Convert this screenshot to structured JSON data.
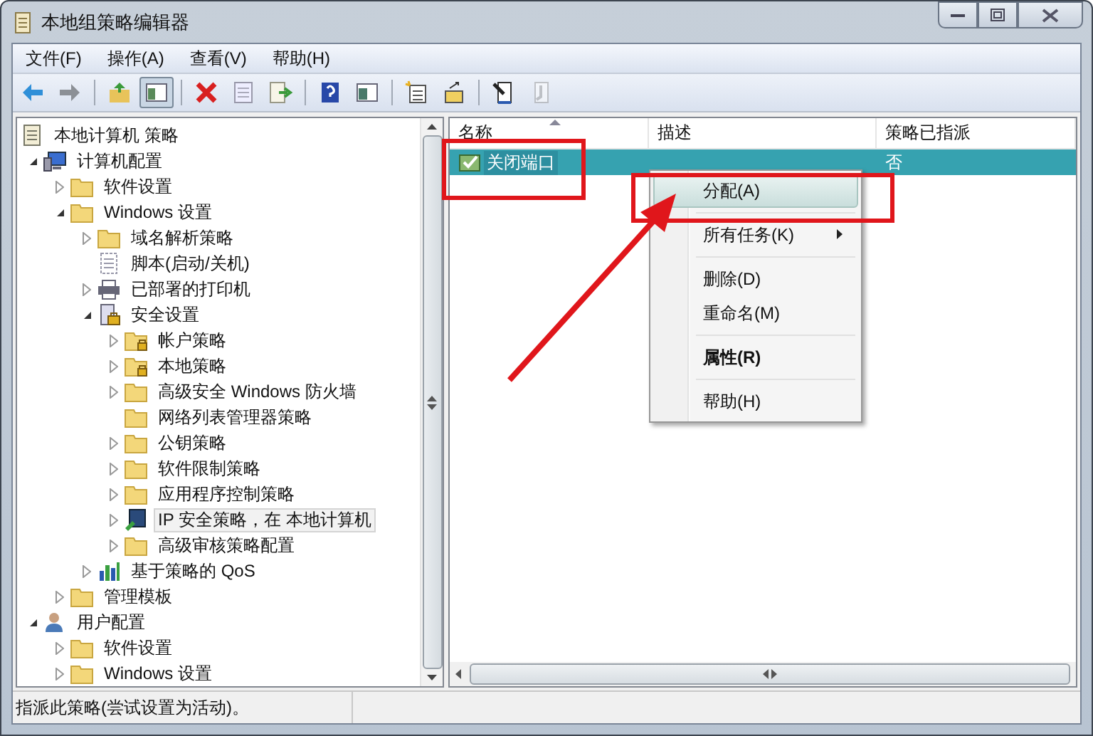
{
  "window": {
    "title": "本地组策略编辑器"
  },
  "menu": [
    {
      "label": "文件(F)"
    },
    {
      "label": "操作(A)"
    },
    {
      "label": "查看(V)"
    },
    {
      "label": "帮助(H)"
    }
  ],
  "toolbar": [
    {
      "kind": "back",
      "separator_before": false,
      "pressed": false,
      "disabled": false
    },
    {
      "kind": "forward",
      "separator_before": false,
      "pressed": false,
      "disabled": false
    },
    {
      "kind": "up",
      "separator_before": true,
      "pressed": false,
      "disabled": false
    },
    {
      "kind": "tree",
      "separator_before": false,
      "pressed": true,
      "disabled": false
    },
    {
      "kind": "delete",
      "separator_before": true,
      "pressed": false,
      "disabled": false
    },
    {
      "kind": "properties",
      "separator_before": false,
      "pressed": false,
      "disabled": false
    },
    {
      "kind": "export",
      "separator_before": false,
      "pressed": false,
      "disabled": false
    },
    {
      "kind": "help",
      "separator_before": true,
      "pressed": false,
      "disabled": false
    },
    {
      "kind": "view",
      "separator_before": false,
      "pressed": false,
      "disabled": false
    },
    {
      "kind": "new",
      "separator_before": true,
      "pressed": false,
      "disabled": false
    },
    {
      "kind": "manage",
      "separator_before": false,
      "pressed": false,
      "disabled": false
    },
    {
      "kind": "assign",
      "separator_before": true,
      "pressed": false,
      "disabled": false
    },
    {
      "kind": "unassign",
      "separator_before": false,
      "pressed": false,
      "disabled": true
    }
  ],
  "tree": {
    "label": "本地计算机 策略",
    "kind": "policy",
    "selected": false,
    "children": [
      {
        "label": "计算机配置",
        "kind": "computer",
        "expanded": true,
        "selected": false,
        "children": [
          {
            "label": "软件设置",
            "kind": "folder",
            "expanded": false,
            "selected": false
          },
          {
            "label": "Windows 设置",
            "kind": "folder",
            "expanded": true,
            "selected": false,
            "children": [
              {
                "label": "域名解析策略",
                "kind": "folder",
                "expanded": false,
                "selected": false
              },
              {
                "label": "脚本(启动/关机)",
                "kind": "script",
                "selected": false
              },
              {
                "label": "已部署的打印机",
                "kind": "printer",
                "expanded": false,
                "selected": false
              },
              {
                "label": "安全设置",
                "kind": "security",
                "expanded": true,
                "selected": false,
                "children": [
                  {
                    "label": "帐户策略",
                    "kind": "lockfolder",
                    "expanded": false,
                    "selected": false
                  },
                  {
                    "label": "本地策略",
                    "kind": "lockfolder",
                    "expanded": false,
                    "selected": false
                  },
                  {
                    "label": "高级安全 Windows 防火墙",
                    "kind": "folder",
                    "expanded": false,
                    "selected": false
                  },
                  {
                    "label": "网络列表管理器策略",
                    "kind": "folder",
                    "selected": false
                  },
                  {
                    "label": "公钥策略",
                    "kind": "folder",
                    "expanded": false,
                    "selected": false
                  },
                  {
                    "label": "软件限制策略",
                    "kind": "folder",
                    "expanded": false,
                    "selected": false
                  },
                  {
                    "label": "应用程序控制策略",
                    "kind": "folder",
                    "expanded": false,
                    "selected": false
                  },
                  {
                    "label": "IP 安全策略，在 本地计算机",
                    "kind": "ipsec",
                    "expanded": false,
                    "selected": true
                  },
                  {
                    "label": "高级审核策略配置",
                    "kind": "folder",
                    "expanded": false,
                    "selected": false
                  }
                ]
              },
              {
                "label": "基于策略的 QoS",
                "kind": "qos",
                "expanded": false,
                "selected": false
              }
            ]
          },
          {
            "label": "管理模板",
            "kind": "folder",
            "expanded": false,
            "selected": false
          }
        ]
      },
      {
        "label": "用户配置",
        "kind": "user",
        "expanded": true,
        "selected": false,
        "children": [
          {
            "label": "软件设置",
            "kind": "folder",
            "expanded": false,
            "selected": false
          },
          {
            "label": "Windows 设置",
            "kind": "folder",
            "expanded": false,
            "selected": false
          }
        ]
      }
    ]
  },
  "table": {
    "columns": [
      {
        "label": "名称",
        "sorted": true
      },
      {
        "label": "描述",
        "sorted": false
      },
      {
        "label": "策略已指派",
        "sorted": false
      }
    ],
    "rows": [
      {
        "cells": [
          "关闭端口",
          "",
          "否"
        ],
        "selected": true
      }
    ]
  },
  "context_menu": [
    {
      "label": "分配(A)",
      "selected": true,
      "submenu": false,
      "default": false,
      "separator_after": true
    },
    {
      "label": "所有任务(K)",
      "selected": false,
      "submenu": true,
      "default": false,
      "separator_after": true
    },
    {
      "label": "删除(D)",
      "selected": false,
      "submenu": false,
      "default": false,
      "separator_after": false
    },
    {
      "label": "重命名(M)",
      "selected": false,
      "submenu": false,
      "default": false,
      "separator_after": true
    },
    {
      "label": "属性(R)",
      "selected": false,
      "submenu": false,
      "default": true,
      "separator_after": true
    },
    {
      "label": "帮助(H)",
      "selected": false,
      "submenu": false,
      "default": false,
      "separator_after": false
    }
  ],
  "status_bar": {
    "text": "指派此策略(尝试设置为活动)。"
  }
}
